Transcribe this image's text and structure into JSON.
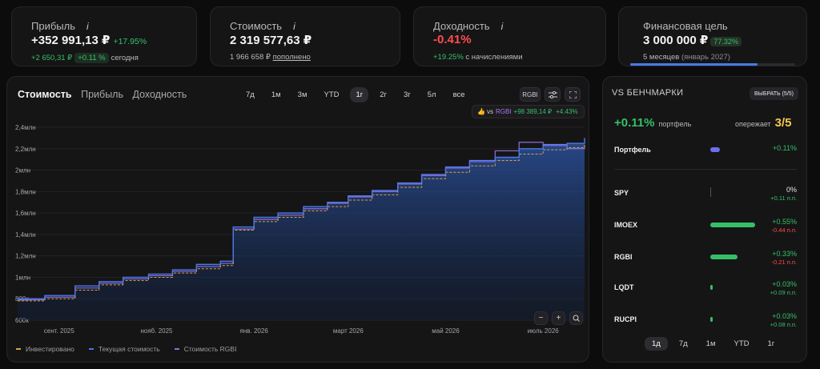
{
  "kpis": {
    "profit": {
      "label": "Прибыль",
      "info": "i",
      "value": "+352 991,13 ₽",
      "pct": "+17.95%",
      "today_value": "+2 650,31 ₽",
      "today_pct": "+0.11 %",
      "today_label": "сегодня"
    },
    "cost": {
      "label": "Стоимость",
      "info": "i",
      "value": "2 319 577,63 ₽",
      "sub_value": "1 966 658 ₽",
      "sub_link": "пополнено"
    },
    "yield": {
      "label": "Доходность",
      "info": "i",
      "value": "-0.41%",
      "sub_value": "+19.25%",
      "sub_label": "с начислениями"
    },
    "goal": {
      "label": "Финансовая цель",
      "value": "3 000 000 ₽",
      "pct": "77.32%",
      "sub": "5 месяцев",
      "sub_date": "(январь 2027)",
      "progress": 0.7732
    }
  },
  "chart_panel": {
    "tabs": [
      "Стоимость",
      "Прибыль",
      "Доходность"
    ],
    "active_tab": "Стоимость",
    "periods": [
      "7д",
      "1м",
      "3м",
      "YTD",
      "1г",
      "2г",
      "3г",
      "5л",
      "все"
    ],
    "active_period": "1г",
    "rgbi_button": "RGBI",
    "compare": {
      "thumb_icon": "thumbs-up-icon",
      "vs": "vs",
      "ticker": "RGBI",
      "value": "+98 389,14 ₽",
      "pct": "+4.43%"
    },
    "legend": [
      {
        "name": "Инвестировано",
        "color": "#e0a040"
      },
      {
        "name": "Текущая стоимость",
        "color": "#4a78e8"
      },
      {
        "name": "Стоимость RGBI",
        "color": "#8f6fd9"
      }
    ],
    "zoom": {
      "minus": "−",
      "plus": "+",
      "reset_icon": "zoom-reset-icon"
    }
  },
  "chart_data": {
    "type": "area",
    "y_ticks": [
      "2,4млн",
      "2,2млн",
      "2млн",
      "1,8млн",
      "1,6млн",
      "1,4млн",
      "1,2млн",
      "1млн",
      "800к",
      "600к"
    ],
    "x_ticks": [
      "сент. 2025",
      "нояб. 2025",
      "янв. 2026",
      "март 2026",
      "май 2026",
      "июль 2026"
    ],
    "ylim": [
      600000,
      2400000
    ],
    "series": [
      {
        "name": "Текущая стоимость",
        "x": [
          "2025-08-15",
          "2025-09-01",
          "2025-09-20",
          "2025-10-05",
          "2025-10-20",
          "2025-11-05",
          "2025-11-20",
          "2025-12-05",
          "2025-12-20",
          "2025-12-28",
          "2026-01-10",
          "2026-01-25",
          "2026-02-10",
          "2026-02-25",
          "2026-03-10",
          "2026-03-25",
          "2026-04-10",
          "2026-04-25",
          "2026-05-10",
          "2026-05-25",
          "2026-06-10",
          "2026-06-25",
          "2026-07-10",
          "2026-07-25",
          "2026-08-05"
        ],
        "values": [
          800000,
          830000,
          920000,
          960000,
          1000000,
          1030000,
          1070000,
          1120000,
          1150000,
          1470000,
          1560000,
          1600000,
          1660000,
          1700000,
          1760000,
          1810000,
          1880000,
          1960000,
          2030000,
          2080000,
          2120000,
          2200000,
          2230000,
          2250000,
          2300000
        ]
      },
      {
        "name": "Инвестировано",
        "x": [
          "2025-08-15",
          "2025-09-01",
          "2025-09-20",
          "2025-10-05",
          "2025-10-20",
          "2025-11-05",
          "2025-11-20",
          "2025-12-05",
          "2025-12-20",
          "2025-12-28",
          "2026-01-10",
          "2026-01-25",
          "2026-02-10",
          "2026-02-25",
          "2026-03-10",
          "2026-03-25",
          "2026-04-10",
          "2026-04-25",
          "2026-05-10",
          "2026-05-25",
          "2026-06-10",
          "2026-06-25",
          "2026-07-10",
          "2026-07-25",
          "2026-08-05"
        ],
        "values": [
          780000,
          800000,
          880000,
          930000,
          970000,
          1000000,
          1040000,
          1080000,
          1110000,
          1440000,
          1520000,
          1560000,
          1620000,
          1660000,
          1720000,
          1770000,
          1840000,
          1920000,
          1980000,
          2040000,
          2090000,
          2150000,
          2190000,
          2210000,
          2240000
        ]
      },
      {
        "name": "Стоимость RGBI",
        "x": [
          "2025-08-15",
          "2025-09-01",
          "2025-09-20",
          "2025-10-05",
          "2025-10-20",
          "2025-11-05",
          "2025-11-20",
          "2025-12-05",
          "2025-12-20",
          "2025-12-28",
          "2026-01-10",
          "2026-01-25",
          "2026-02-10",
          "2026-02-25",
          "2026-03-10",
          "2026-03-25",
          "2026-04-10",
          "2026-04-25",
          "2026-05-10",
          "2026-05-25",
          "2026-06-10",
          "2026-06-25",
          "2026-07-10",
          "2026-07-25",
          "2026-08-05"
        ],
        "values": [
          790000,
          815000,
          900000,
          945000,
          985000,
          1015000,
          1055000,
          1100000,
          1130000,
          1450000,
          1540000,
          1580000,
          1640000,
          1690000,
          1750000,
          1800000,
          1870000,
          1950000,
          2020000,
          2090000,
          2180000,
          2260000,
          2240000,
          2200000,
          2230000
        ]
      }
    ]
  },
  "benchmarks": {
    "title": "VS БЕНЧМАРКИ",
    "select_button": "ВЫБРАТЬ (5/5)",
    "portfolio_pct": "+0.11%",
    "portfolio_label": "портфель",
    "ahead_label": "опережает",
    "ahead_value": "3/5",
    "portfolio_row": {
      "name": "Портфель",
      "value": "+0.11%"
    },
    "rows": [
      {
        "name": "SPY",
        "value": "0%",
        "diff": "+0.11 п.п.",
        "value_color": "#e6e6ea",
        "diff_color": "#35c067",
        "bar": 0.0
      },
      {
        "name": "IMOEX",
        "value": "+0.55%",
        "diff": "-0.44 п.п.",
        "value_color": "#35c067",
        "diff_color": "#ff4d4f",
        "bar": 0.55
      },
      {
        "name": "RGBI",
        "value": "+0.33%",
        "diff": "-0.21 п.п.",
        "value_color": "#35c067",
        "diff_color": "#ff4d4f",
        "bar": 0.33
      },
      {
        "name": "LQDT",
        "value": "+0.03%",
        "diff": "+0.09 п.п.",
        "value_color": "#35c067",
        "diff_color": "#35c067",
        "bar": 0.03
      },
      {
        "name": "RUCPI",
        "value": "+0.03%",
        "diff": "+0.08 п.п.",
        "value_color": "#35c067",
        "diff_color": "#35c067",
        "bar": 0.03
      }
    ],
    "periods": [
      "1д",
      "7д",
      "1м",
      "YTD",
      "1г"
    ],
    "active_period": "1д"
  }
}
